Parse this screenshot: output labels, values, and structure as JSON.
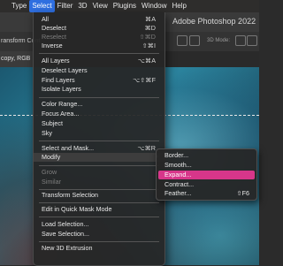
{
  "menubar": {
    "items": [
      "Type",
      "Select",
      "Filter",
      "3D",
      "View",
      "Plugins",
      "Window",
      "Help"
    ],
    "active": "Select"
  },
  "titlebar": {
    "title": "Adobe Photoshop 2022"
  },
  "options_bar": {
    "left_label": "ransform Cont",
    "mode_label": "3D Mode:"
  },
  "tab_bar": {
    "doc_tab": "copy, RGB"
  },
  "select_menu": {
    "items": [
      {
        "label": "All",
        "shortcut": "⌘A",
        "enabled": true
      },
      {
        "label": "Deselect",
        "shortcut": "⌘D",
        "enabled": true
      },
      {
        "label": "Reselect",
        "shortcut": "⇧⌘D",
        "enabled": false
      },
      {
        "label": "Inverse",
        "shortcut": "⇧⌘I",
        "enabled": true
      },
      {
        "label": "All Layers",
        "shortcut": "⌥⌘A",
        "enabled": true
      },
      {
        "label": "Deselect Layers",
        "shortcut": "",
        "enabled": true
      },
      {
        "label": "Find Layers",
        "shortcut": "⌥⇧⌘F",
        "enabled": true
      },
      {
        "label": "Isolate Layers",
        "shortcut": "",
        "enabled": true
      },
      {
        "label": "Color Range...",
        "shortcut": "",
        "enabled": true
      },
      {
        "label": "Focus Area...",
        "shortcut": "",
        "enabled": true
      },
      {
        "label": "Subject",
        "shortcut": "",
        "enabled": true
      },
      {
        "label": "Sky",
        "shortcut": "",
        "enabled": true
      },
      {
        "label": "Select and Mask...",
        "shortcut": "⌥⌘R",
        "enabled": true
      },
      {
        "label": "Modify",
        "shortcut": "",
        "enabled": true,
        "submenu": true
      },
      {
        "label": "Grow",
        "shortcut": "",
        "enabled": false
      },
      {
        "label": "Similar",
        "shortcut": "",
        "enabled": false
      },
      {
        "label": "Transform Selection",
        "shortcut": "",
        "enabled": true
      },
      {
        "label": "Edit in Quick Mask Mode",
        "shortcut": "",
        "enabled": true
      },
      {
        "label": "Load Selection...",
        "shortcut": "",
        "enabled": true
      },
      {
        "label": "Save Selection...",
        "shortcut": "",
        "enabled": true
      },
      {
        "label": "New 3D Extrusion",
        "shortcut": "",
        "enabled": true
      }
    ],
    "submenu_arrow": "›"
  },
  "modify_submenu": {
    "items": [
      {
        "label": "Border...",
        "shortcut": ""
      },
      {
        "label": "Smooth...",
        "shortcut": ""
      },
      {
        "label": "Expand...",
        "shortcut": "",
        "active": true
      },
      {
        "label": "Contract...",
        "shortcut": ""
      },
      {
        "label": "Feather...",
        "shortcut": "⇧F6"
      }
    ]
  },
  "colors": {
    "menubar_highlight": "#2f6fe0",
    "submenu_highlight": "#d7368a",
    "menu_bg": "#262626"
  }
}
